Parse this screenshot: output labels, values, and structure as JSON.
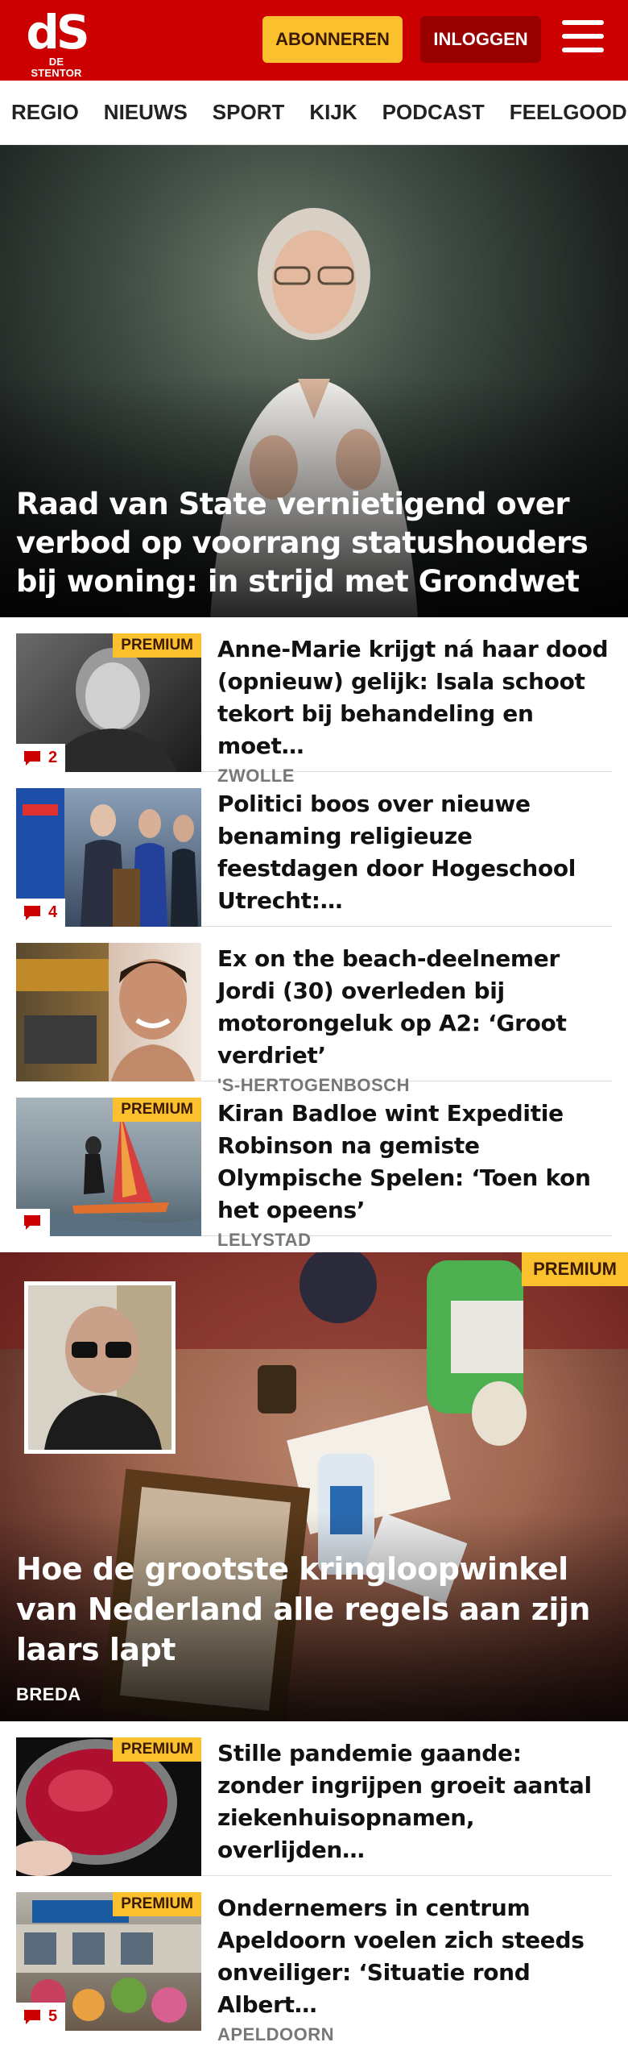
{
  "header": {
    "logo_mark": "dS",
    "logo_sub": "DE STENTOR",
    "subscribe_label": "ABONNEREN",
    "login_label": "INLOGGEN"
  },
  "nav": {
    "items": [
      "REGIO",
      "NIEUWS",
      "SPORT",
      "KIJK",
      "PODCAST",
      "FEELGOOD"
    ]
  },
  "hero": {
    "title": "Raad van State vernietigend over verbod op voorrang statushouders bij woning: in strijd met Grondwet"
  },
  "articles": [
    {
      "title": "Anne-Marie krijgt ná haar dood (opnieuw) gelijk: Isala schoot tekort bij behandeling en moet…",
      "city": "ZWOLLE",
      "premium": "PREMIUM",
      "comments": "2"
    },
    {
      "title": "Politici boos over nieuwe benaming religieuze feestdagen door Hogeschool Utrecht:…",
      "city": "",
      "premium": "",
      "comments": "4"
    },
    {
      "title": "Ex on the beach-deelnemer Jordi (30) overleden bij motorongeluk op A2: ‘Groot verdriet’",
      "city": "'S-HERTOGENBOSCH",
      "premium": "",
      "comments": ""
    },
    {
      "title": "Kiran Badloe wint Expeditie Robinson na gemiste Olympische Spelen: ‘Toen kon het opeens’",
      "city": "LELYSTAD",
      "premium": "PREMIUM",
      "comments": ""
    }
  ],
  "feature": {
    "premium": "PREMIUM",
    "title": "Hoe de grootste kringloopwinkel van Nederland alle regels aan zijn laars lapt",
    "city": "BREDA"
  },
  "articles2": [
    {
      "title": "Stille pandemie gaande: zonder ingrijpen groeit aantal ziekenhuisopnamen, overlijden…",
      "city": "",
      "premium": "PREMIUM",
      "comments": ""
    },
    {
      "title": "Ondernemers in centrum Apeldoorn voelen zich steeds onveiliger: ‘Situatie rond Albert…",
      "city": "APELDOORN",
      "premium": "PREMIUM",
      "comments": "5"
    }
  ],
  "colors": {
    "brand_red": "#cc0000",
    "premium_yellow": "#fbc02d",
    "login_dark_red": "#990000"
  },
  "icons": [
    "menu-icon",
    "comment-icon"
  ]
}
